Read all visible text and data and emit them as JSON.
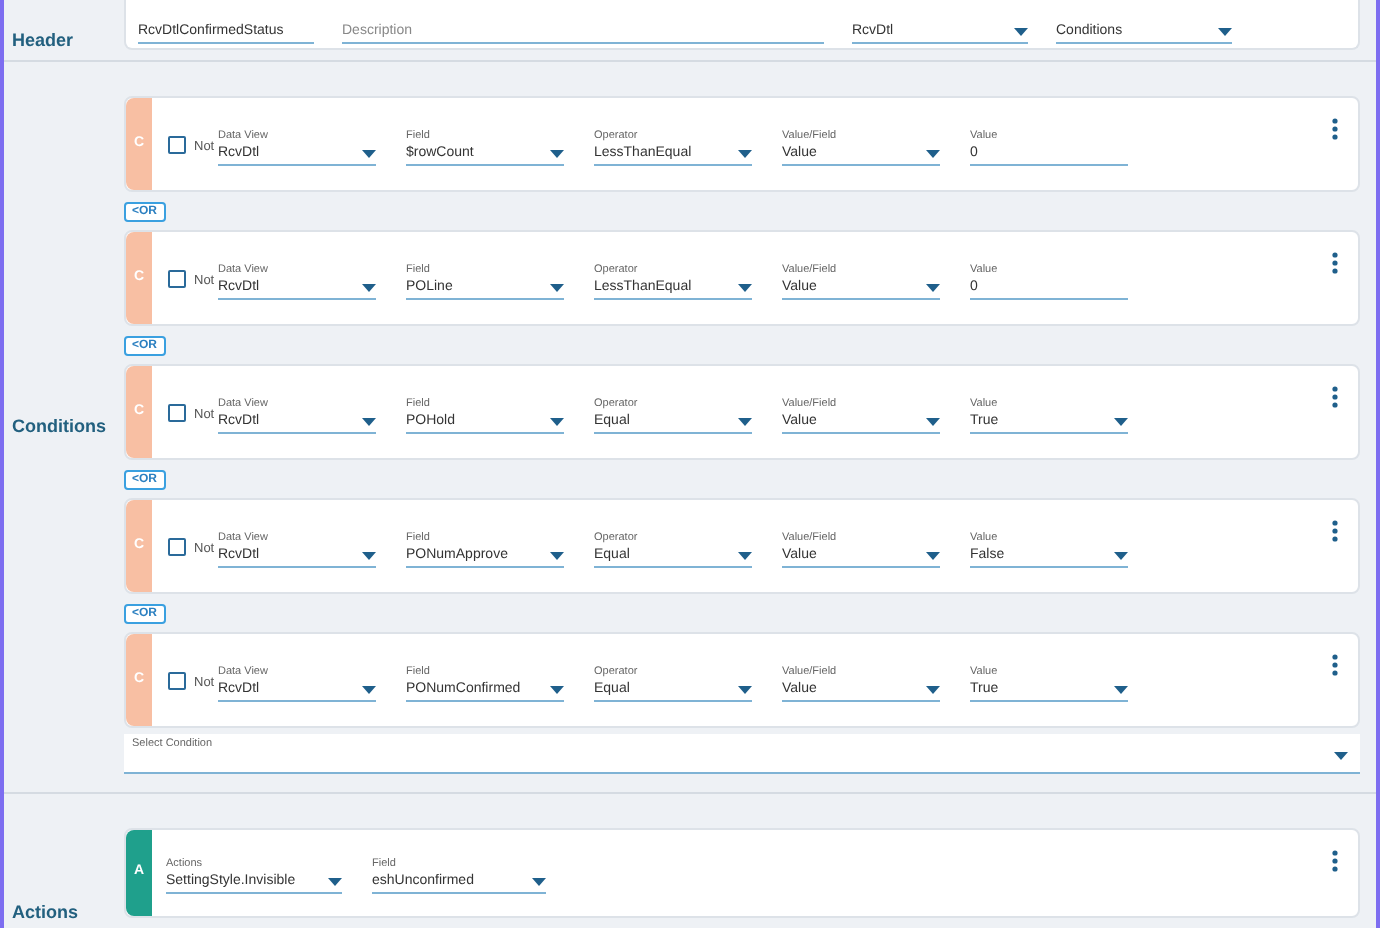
{
  "header": {
    "title": "Header",
    "fields": [
      {
        "kind": "input",
        "value": "RcvDtlConfirmedStatus"
      },
      {
        "kind": "input",
        "placeholder": "Description"
      },
      {
        "kind": "dropdown",
        "value": "RcvDtl"
      },
      {
        "kind": "dropdown",
        "value": "Conditions"
      }
    ]
  },
  "conditions": {
    "title": "Conditions",
    "items": [
      {
        "badge": "C",
        "not_label": "Not",
        "not_checked": false,
        "connector": "<OR",
        "fields": [
          {
            "label": "Data View",
            "value": "RcvDtl",
            "kind": "dropdown"
          },
          {
            "label": "Field",
            "value": "$rowCount",
            "kind": "dropdown"
          },
          {
            "label": "Operator",
            "value": "LessThanEqual",
            "kind": "dropdown"
          },
          {
            "label": "Value/Field",
            "value": "Value",
            "kind": "dropdown"
          },
          {
            "label": "Value",
            "value": "0",
            "kind": "input"
          }
        ]
      },
      {
        "badge": "C",
        "not_label": "Not",
        "not_checked": false,
        "connector": "<OR",
        "fields": [
          {
            "label": "Data View",
            "value": "RcvDtl",
            "kind": "dropdown"
          },
          {
            "label": "Field",
            "value": "POLine",
            "kind": "dropdown"
          },
          {
            "label": "Operator",
            "value": "LessThanEqual",
            "kind": "dropdown"
          },
          {
            "label": "Value/Field",
            "value": "Value",
            "kind": "dropdown"
          },
          {
            "label": "Value",
            "value": "0",
            "kind": "input"
          }
        ]
      },
      {
        "badge": "C",
        "not_label": "Not",
        "not_checked": false,
        "connector": "<OR",
        "fields": [
          {
            "label": "Data View",
            "value": "RcvDtl",
            "kind": "dropdown"
          },
          {
            "label": "Field",
            "value": "POHold",
            "kind": "dropdown"
          },
          {
            "label": "Operator",
            "value": "Equal",
            "kind": "dropdown"
          },
          {
            "label": "Value/Field",
            "value": "Value",
            "kind": "dropdown"
          },
          {
            "label": "Value",
            "value": "True",
            "kind": "dropdown"
          }
        ]
      },
      {
        "badge": "C",
        "not_label": "Not",
        "not_checked": false,
        "connector": "<OR",
        "fields": [
          {
            "label": "Data View",
            "value": "RcvDtl",
            "kind": "dropdown"
          },
          {
            "label": "Field",
            "value": "PONumApprove",
            "kind": "dropdown"
          },
          {
            "label": "Operator",
            "value": "Equal",
            "kind": "dropdown"
          },
          {
            "label": "Value/Field",
            "value": "Value",
            "kind": "dropdown"
          },
          {
            "label": "Value",
            "value": "False",
            "kind": "dropdown"
          }
        ]
      },
      {
        "badge": "C",
        "not_label": "Not",
        "not_checked": false,
        "fields": [
          {
            "label": "Data View",
            "value": "RcvDtl",
            "kind": "dropdown"
          },
          {
            "label": "Field",
            "value": "PONumConfirmed",
            "kind": "dropdown"
          },
          {
            "label": "Operator",
            "value": "Equal",
            "kind": "dropdown"
          },
          {
            "label": "Value/Field",
            "value": "Value",
            "kind": "dropdown"
          },
          {
            "label": "Value",
            "value": "True",
            "kind": "dropdown"
          }
        ]
      }
    ],
    "select_condition": {
      "label": "Select Condition"
    }
  },
  "actions": {
    "title": "Actions",
    "items": [
      {
        "badge": "A",
        "fields": [
          {
            "label": "Actions",
            "value": "SettingStyle.Invisible",
            "kind": "dropdown"
          },
          {
            "label": "Field",
            "value": "eshUnconfirmed",
            "kind": "dropdown"
          }
        ]
      }
    ]
  }
}
